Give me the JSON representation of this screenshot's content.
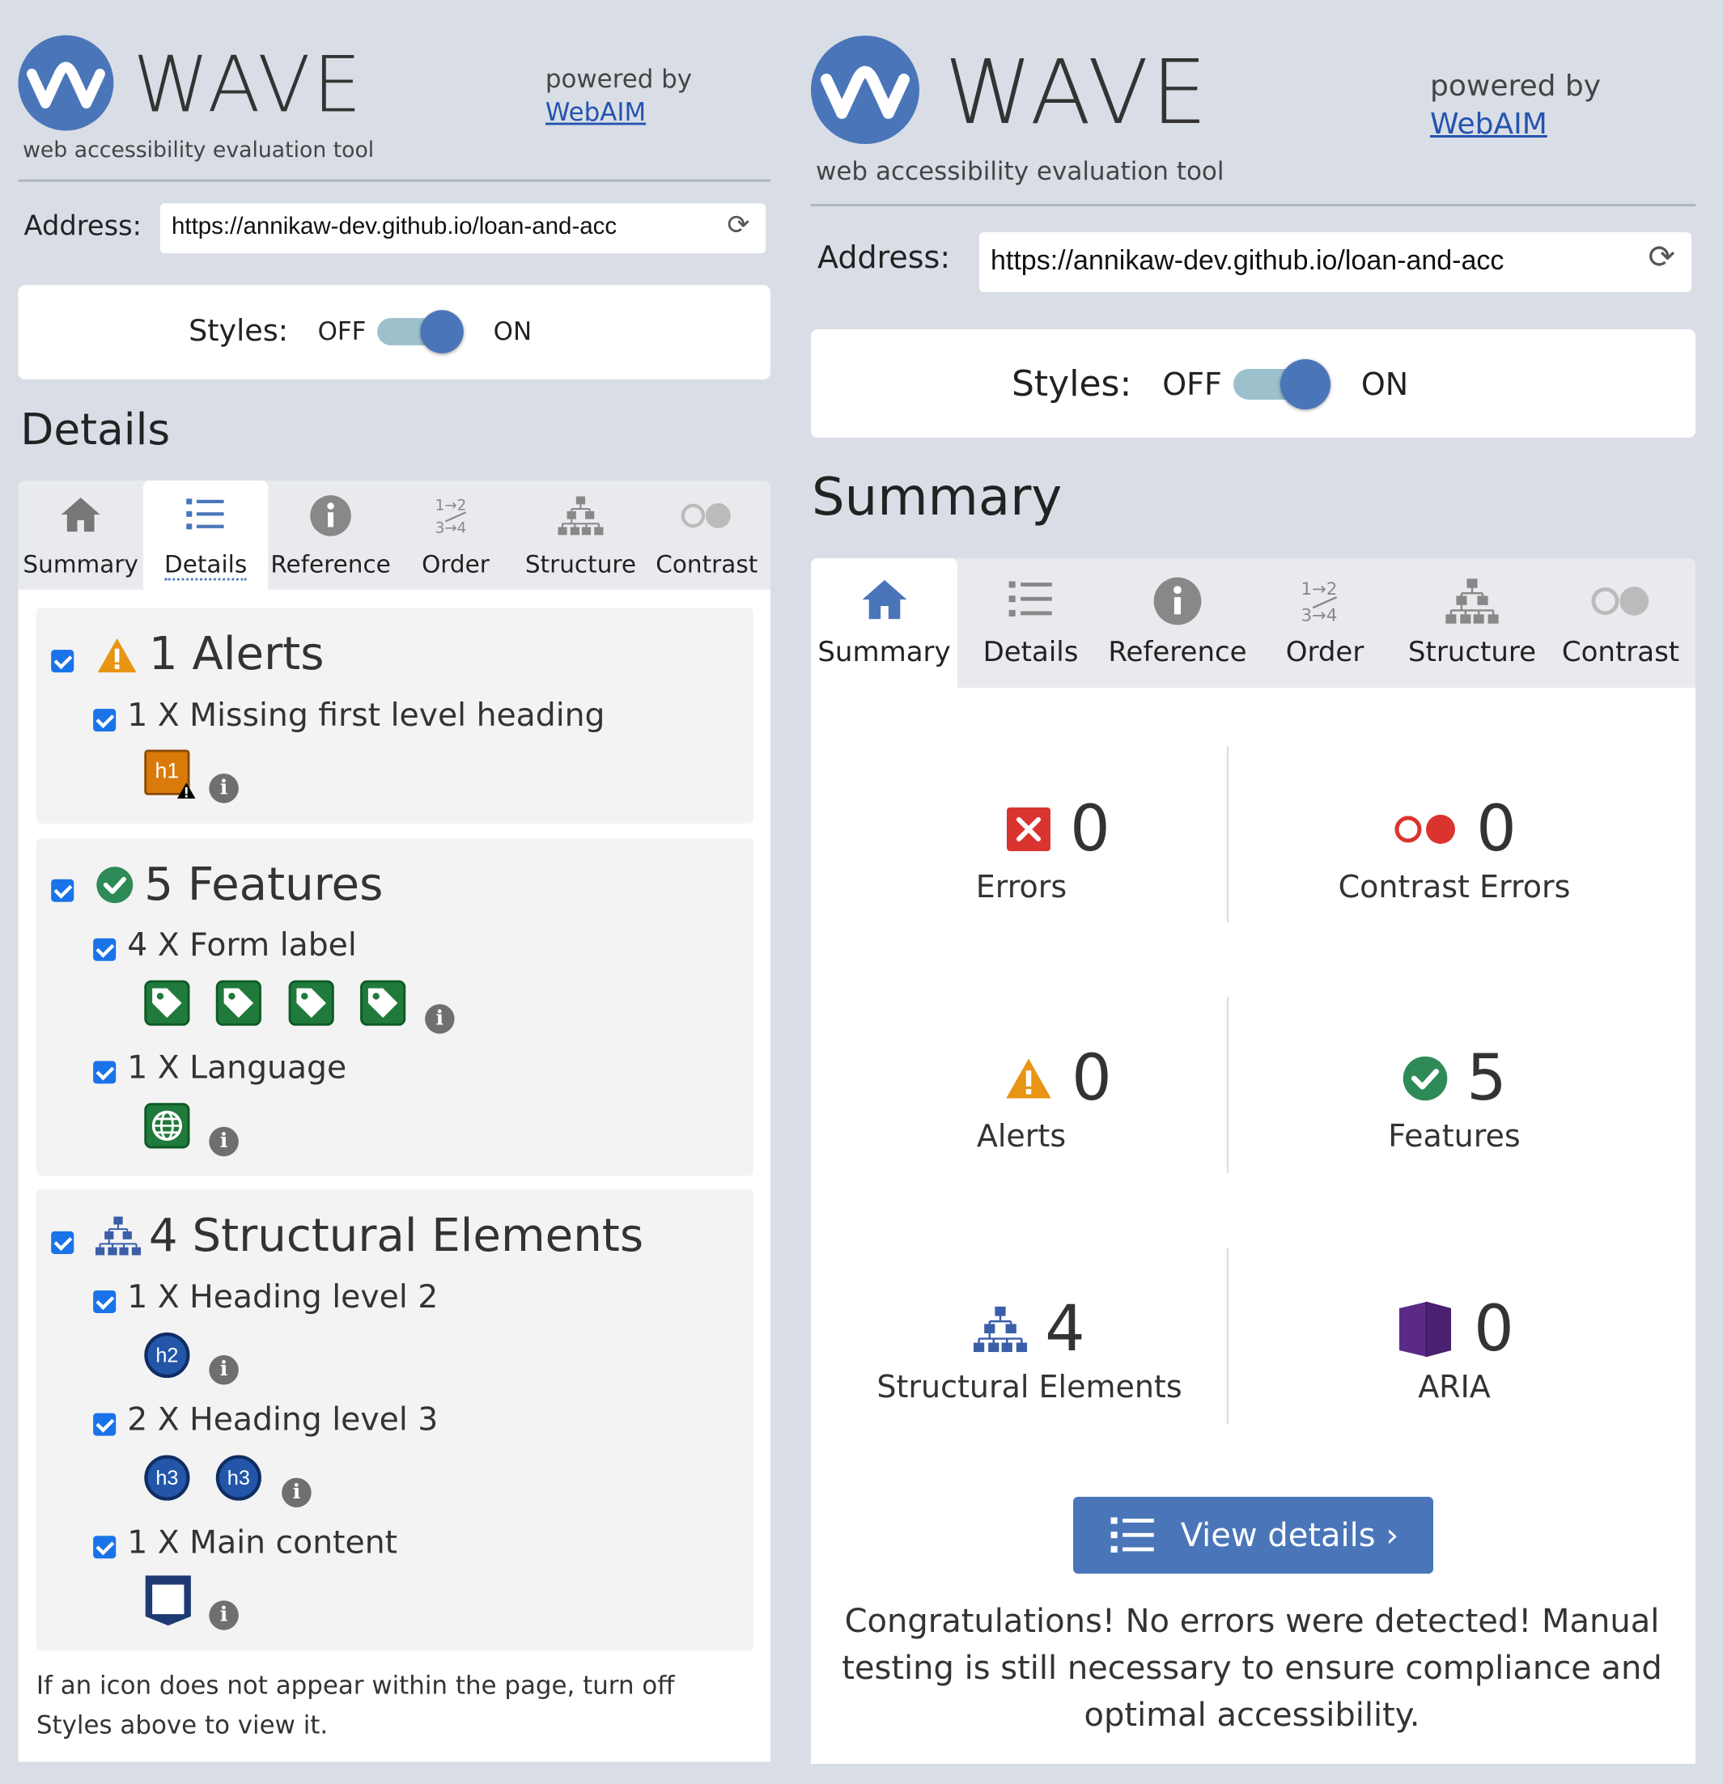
{
  "left": {
    "logo": {
      "word": "WAVE",
      "subtitle": "web accessibility evaluation tool"
    },
    "powered_by": {
      "text": "powered by",
      "link": "WebAIM"
    },
    "address": {
      "label": "Address:",
      "value": "https://annikaw-dev.github.io/loan-and-acc"
    },
    "styles": {
      "label": "Styles:",
      "off": "OFF",
      "on": "ON",
      "state": "on"
    },
    "section_title": "Details",
    "tabs": [
      {
        "label": "Summary",
        "icon": "home-icon",
        "active": false
      },
      {
        "label": "Details",
        "icon": "list-icon",
        "active": true
      },
      {
        "label": "Reference",
        "icon": "info-icon",
        "active": false
      },
      {
        "label": "Order",
        "icon": "order-icon",
        "active": false
      },
      {
        "label": "Structure",
        "icon": "structure-icon",
        "active": false
      },
      {
        "label": "Contrast",
        "icon": "contrast-icon",
        "active": false
      }
    ],
    "groups": {
      "alerts": {
        "title": "1 Alerts",
        "items": [
          {
            "text": "1 X Missing first level heading",
            "icons": [
              "h1"
            ]
          }
        ]
      },
      "features": {
        "title": "5 Features",
        "items": [
          {
            "text": "4 X Form label"
          },
          {
            "text": "1 X Language"
          }
        ]
      },
      "structural": {
        "title": "4 Structural Elements",
        "items": [
          {
            "text": "1 X Heading level 2",
            "icons": [
              "h2"
            ]
          },
          {
            "text": "2 X Heading level 3",
            "icons": [
              "h3",
              "h3"
            ]
          },
          {
            "text": "1 X Main content"
          }
        ]
      }
    },
    "note": "If an icon does not appear within the page, turn off Styles above to view it."
  },
  "right": {
    "logo": {
      "word": "WAVE",
      "subtitle": "web accessibility evaluation tool"
    },
    "powered_by": {
      "text": "powered by",
      "link": "WebAIM"
    },
    "address": {
      "label": "Address:",
      "value": "https://annikaw-dev.github.io/loan-and-acc"
    },
    "styles": {
      "label": "Styles:",
      "off": "OFF",
      "on": "ON",
      "state": "on"
    },
    "section_title": "Summary",
    "tabs": [
      {
        "label": "Summary",
        "icon": "home-icon",
        "active": true
      },
      {
        "label": "Details",
        "icon": "list-icon",
        "active": false
      },
      {
        "label": "Reference",
        "icon": "info-icon",
        "active": false
      },
      {
        "label": "Order",
        "icon": "order-icon",
        "active": false
      },
      {
        "label": "Structure",
        "icon": "structure-icon",
        "active": false
      },
      {
        "label": "Contrast",
        "icon": "contrast-icon",
        "active": false
      }
    ],
    "summary": {
      "errors": {
        "count": "0",
        "label": "Errors"
      },
      "contrast_errors": {
        "count": "0",
        "label": "Contrast Errors"
      },
      "alerts": {
        "count": "0",
        "label": "Alerts"
      },
      "features": {
        "count": "5",
        "label": "Features"
      },
      "structural": {
        "count": "4",
        "label": "Structural Elements"
      },
      "aria": {
        "count": "0",
        "label": "ARIA"
      }
    },
    "view_details": "View details ›",
    "congrats": "Congratulations! No errors were detected! Manual testing is still necessary to ensure compliance and optimal accessibility."
  },
  "colors": {
    "brand_blue": "#4a76b9",
    "panel_bg": "#d9dee6",
    "alert_orange": "#e89414",
    "feature_green": "#2e8b57",
    "error_red": "#d9352e",
    "aria_purple": "#5b2a86"
  }
}
